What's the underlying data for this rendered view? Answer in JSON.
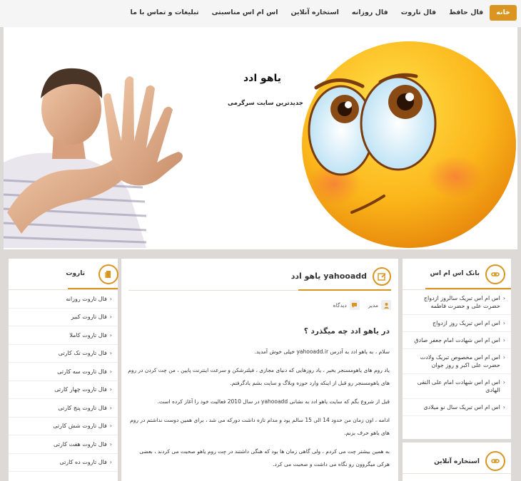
{
  "nav": {
    "items": [
      {
        "label": "خانه",
        "active": true
      },
      {
        "label": "فال حافظ",
        "active": false
      },
      {
        "label": "فال تاروت",
        "active": false
      },
      {
        "label": "فال روزانه",
        "active": false
      },
      {
        "label": "استخاره آنلاین",
        "active": false
      },
      {
        "label": "اس ام اس مناسبتی",
        "active": false
      },
      {
        "label": "تبلیغات و تماس با ما",
        "active": false
      }
    ]
  },
  "header": {
    "site_title": "یاهو ادد",
    "tagline": "جدیدترین سایت سرگرمی"
  },
  "left_widget": {
    "title": "تاروت",
    "items": [
      "فال تاروت روزانه",
      "فال تاروت کبیر",
      "فال تاروت کاملا",
      "فال تاروت تک کارتی",
      "فال تاروت سه کارتی",
      "فال تاروت چهار کارتی",
      "فال تاروت پنج کارتی",
      "فال تاروت شش کارتی",
      "فال تاروت هفت کارتی",
      "فال تاروت ده کارتی"
    ]
  },
  "main": {
    "post_title": "یاهو ادد yahooadd",
    "meta_author": "مدیر",
    "meta_comments": "دیدگاه",
    "heading": "در یاهو ادد چه میگذرد ؟",
    "paragraphs": [
      "سلام ، به یاهو ادد به آدرس yahooadd.ir خیلی خوش آمدید.",
      "یاد روم های یاهومسنجر بخیر ، یاد روزهایی که دنیای مجازی ، فیلترشکن و سرعت اینترنت پایین ، من چت کردن در روم های یاهومسنجر رو قبل از اینکه وارد حوزه وبلاگ و سایت بشم یادگرفتم.",
      "قبل از شروع بگم که سایت یاهو ادد به نشانی yahooadd در سال 2010 فعالیت خود را آغاز کرده است.",
      "ادامه ، اون زمان من حدود 14 الی 15 سالم بود و مدام تازه داشت دورکه می شد ، برای همین دوست نداشتم در روم های یاهو حرف بزنم.",
      "به همین بیشتر چت می کردم ، ولی گاهی زمان ها بود که هنگی داشتند در چت روم یاهو صحبت می کردند ، بعضی هرکی میگروون رو نگاه می داشت و صحبت می کرد."
    ]
  },
  "right_widget": {
    "title": "بانک اس ام اس",
    "items": [
      "اس ام اس تبریک سالروز ازدواج حضرت علی و حضرت فاطمه",
      "اس ام اس تبریک روز ازدواج",
      "اس ام اس شهادت امام جعفر صادق",
      "اس ام اس مخصوص تبریک ولادت حضرت علی اکبر و روز جوان",
      "اس ام اس شهادت امام علی النقی الهادی",
      "اس ام اس تبریک سال نو میلادی"
    ]
  },
  "right_widget2": {
    "title": "استخاره آنلاین"
  },
  "colors": {
    "accent": "#d99520",
    "background": "#ddd9d6",
    "panel": "#ffffff"
  }
}
